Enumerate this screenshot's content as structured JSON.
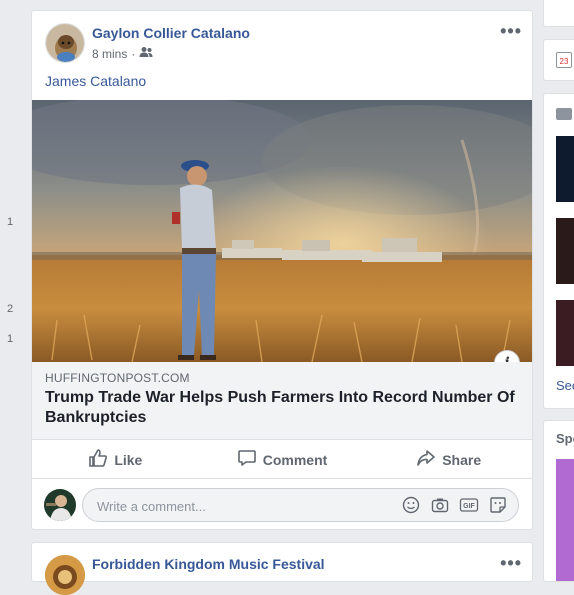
{
  "left_numbers": [
    "1",
    "2",
    "1"
  ],
  "post": {
    "author": "Gaylon Collier Catalano",
    "time": "8 mins",
    "separator": "·",
    "privacy_icon": "friends-icon",
    "menu_dots": "•••",
    "text": "James Catalano",
    "link": {
      "domain": "HUFFINGTONPOST.COM",
      "headline": "Trump Trade War Helps Push Farmers Into Record Number Of Bankruptcies",
      "info_label": "i"
    },
    "actions": {
      "like": "Like",
      "comment": "Comment",
      "share": "Share"
    },
    "comment_box": {
      "placeholder": "Write a comment...",
      "gif_label": "GIF"
    }
  },
  "next_post": {
    "author": "Forbidden Kingdom Music Festival",
    "menu_dots": "•••"
  },
  "right_rail": {
    "calendar_day": "23",
    "see_label": "See",
    "sponsored_label": "Spo"
  },
  "colors": {
    "link_blue": "#385898",
    "background": "#e9ebee",
    "muted": "#606770"
  }
}
